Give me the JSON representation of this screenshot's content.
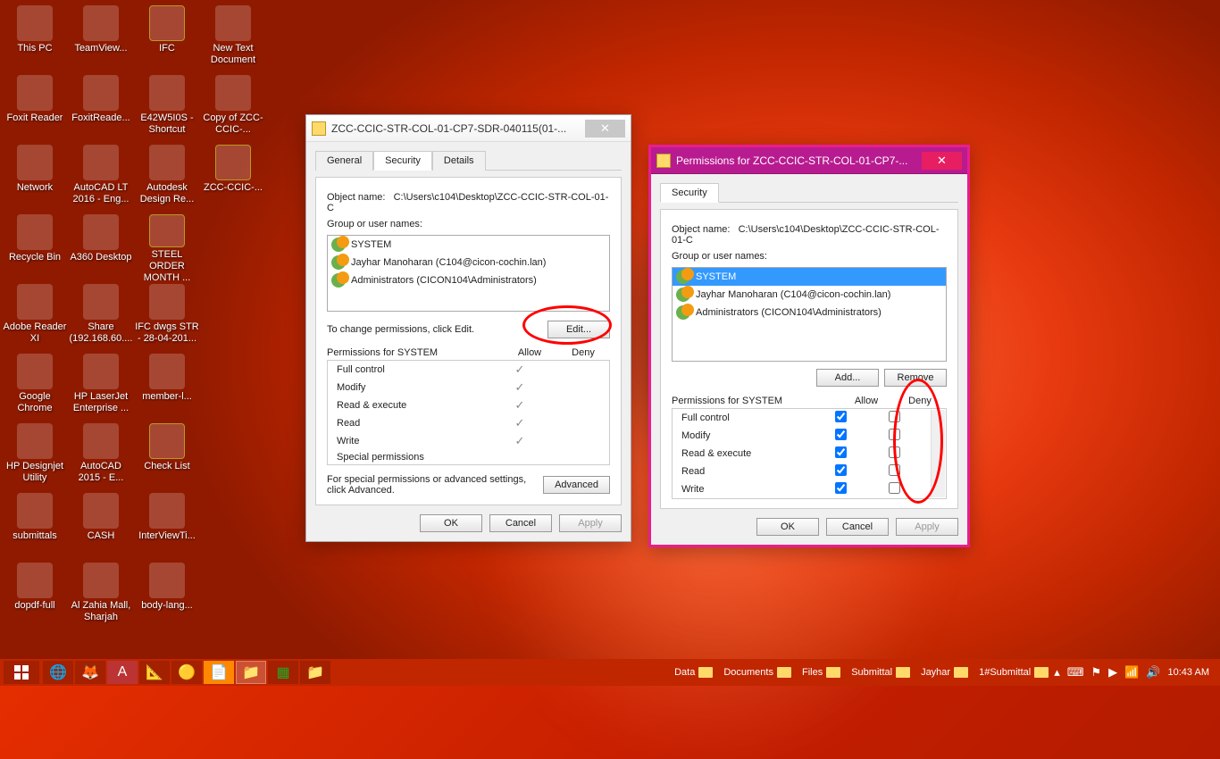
{
  "desktop_icons": [
    {
      "label": "This PC"
    },
    {
      "label": "TeamView..."
    },
    {
      "label": "IFC"
    },
    {
      "label": "New Text Document"
    },
    {
      "label": "Foxit Reader"
    },
    {
      "label": "FoxitReade..."
    },
    {
      "label": "E42W5I0S - Shortcut"
    },
    {
      "label": "Copy of ZCC-CCIC-..."
    },
    {
      "label": "Network"
    },
    {
      "label": "AutoCAD LT 2016 - Eng..."
    },
    {
      "label": "Autodesk Design Re..."
    },
    {
      "label": "ZCC-CCIC-..."
    },
    {
      "label": "Recycle Bin"
    },
    {
      "label": "A360 Desktop"
    },
    {
      "label": "STEEL ORDER MONTH ..."
    },
    {
      "label": ""
    },
    {
      "label": "Adobe Reader XI"
    },
    {
      "label": "Share (192.168.60...."
    },
    {
      "label": "IFC dwgs STR - 28-04-201..."
    },
    {
      "label": ""
    },
    {
      "label": "Google Chrome"
    },
    {
      "label": "HP LaserJet Enterprise ..."
    },
    {
      "label": "member-l..."
    },
    {
      "label": ""
    },
    {
      "label": "HP Designjet Utility"
    },
    {
      "label": "AutoCAD 2015 - E..."
    },
    {
      "label": "Check List"
    },
    {
      "label": ""
    },
    {
      "label": "submittals"
    },
    {
      "label": "CASH"
    },
    {
      "label": "InterViewTi..."
    },
    {
      "label": ""
    },
    {
      "label": "dopdf-full"
    },
    {
      "label": "Al Zahia Mall, Sharjah"
    },
    {
      "label": "body-lang..."
    },
    {
      "label": ""
    }
  ],
  "winA": {
    "title": "ZCC-CCIC-STR-COL-01-CP7-SDR-040115(01-...",
    "tabs": {
      "general": "General",
      "security": "Security",
      "details": "Details"
    },
    "object_label": "Object name:",
    "object_value": "C:\\Users\\c104\\Desktop\\ZCC-CCIC-STR-COL-01-C",
    "group_label": "Group or user names:",
    "users": [
      {
        "name": "SYSTEM"
      },
      {
        "name": "Jayhar Manoharan (C104@cicon-cochin.lan)"
      },
      {
        "name": "Administrators (CICON104\\Administrators)"
      }
    ],
    "edit_hint": "To change permissions, click Edit.",
    "edit_btn": "Edit...",
    "perm_label": "Permissions for SYSTEM",
    "allow": "Allow",
    "deny": "Deny",
    "perms": [
      "Full control",
      "Modify",
      "Read & execute",
      "Read",
      "Write",
      "Special permissions"
    ],
    "adv_hint": "For special permissions or advanced settings, click Advanced.",
    "adv_btn": "Advanced",
    "ok": "OK",
    "cancel": "Cancel",
    "apply": "Apply"
  },
  "winB": {
    "title": "Permissions for ZCC-CCIC-STR-COL-01-CP7-...",
    "tab": "Security",
    "object_label": "Object name:",
    "object_value": "C:\\Users\\c104\\Desktop\\ZCC-CCIC-STR-COL-01-C",
    "group_label": "Group or user names:",
    "users": [
      {
        "name": "SYSTEM",
        "selected": true
      },
      {
        "name": "Jayhar Manoharan (C104@cicon-cochin.lan)"
      },
      {
        "name": "Administrators (CICON104\\Administrators)"
      }
    ],
    "add": "Add...",
    "remove": "Remove",
    "perm_label": "Permissions for SYSTEM",
    "allow": "Allow",
    "deny": "Deny",
    "perms": [
      {
        "name": "Full control",
        "allow": true,
        "deny": false
      },
      {
        "name": "Modify",
        "allow": true,
        "deny": false
      },
      {
        "name": "Read & execute",
        "allow": true,
        "deny": false
      },
      {
        "name": "Read",
        "allow": true,
        "deny": false
      },
      {
        "name": "Write",
        "allow": true,
        "deny": false
      }
    ],
    "ok": "OK",
    "cancel": "Cancel",
    "apply": "Apply"
  },
  "taskbar": {
    "pins": [
      "start",
      "ie",
      "firefox",
      "autocad",
      "autodesk",
      "chrome",
      "foxit",
      "explorer",
      "excel",
      "explorer2"
    ],
    "folders": [
      {
        "label": "Data"
      },
      {
        "label": "Documents"
      },
      {
        "label": "Files"
      },
      {
        "label": "Submittal"
      },
      {
        "label": "Jayhar"
      },
      {
        "label": "1#Submittal"
      }
    ],
    "clock": "10:43 AM"
  }
}
